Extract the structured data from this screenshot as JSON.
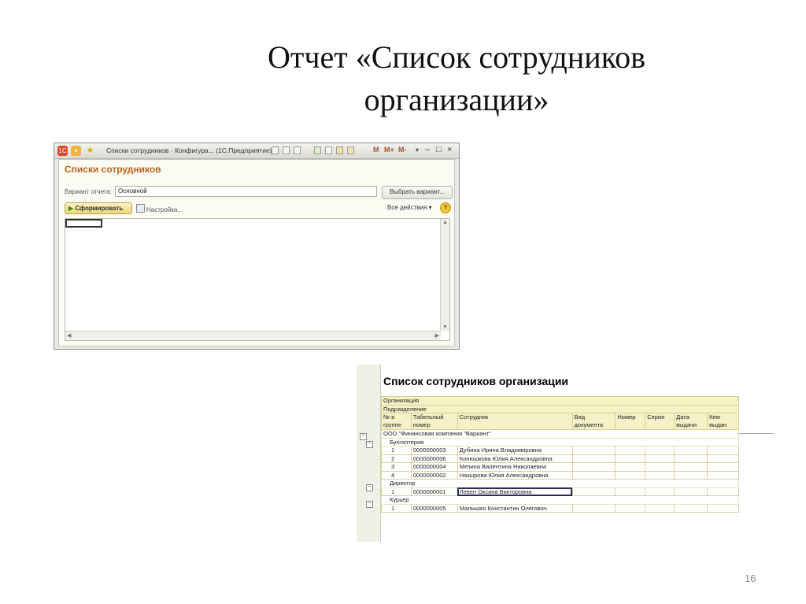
{
  "slide": {
    "title_line1": "Отчет «Список сотрудников",
    "title_line2": "организации»",
    "page_number": "16"
  },
  "window": {
    "title": "Списки сотрудников - Конфигура... (1С:Предприятие)",
    "toolbar_m_labels": [
      "M",
      "M+",
      "M-"
    ],
    "controls": {
      "minimize": "–",
      "maximize": "□",
      "close": "×"
    },
    "form_heading": "Списки сотрудников",
    "variant_label": "Вариант отчета:",
    "variant_value": "Основной",
    "choose_variant_button": "Выбрать вариант...",
    "generate_button": "Сформировать",
    "settings_link": "Настройка...",
    "all_actions": "Все действия",
    "help": "?"
  },
  "report": {
    "title": "Список сотрудников организации",
    "param_org": "Организация",
    "param_dept": "Подразделение",
    "columns": [
      [
        "№ в",
        "группе"
      ],
      [
        "Табельный",
        "номер"
      ],
      [
        "Сотрудник",
        ""
      ],
      [
        "Вид",
        "документа"
      ],
      [
        "Номер",
        ""
      ],
      [
        "Серия",
        ""
      ],
      [
        "Дата",
        "выдачи"
      ],
      [
        "Кем",
        "выдан"
      ]
    ],
    "organization": "ООО \"Финансовая компания \"Вариант\"",
    "groups": [
      {
        "name": "Бухгалтерия",
        "rows": [
          [
            "1",
            "0000000003",
            "Дубина Ирина Владимировна"
          ],
          [
            "2",
            "0000000006",
            "Конюшкова Юлия Александровна"
          ],
          [
            "3",
            "0000000004",
            "Мезина Валентина Николаевна"
          ],
          [
            "4",
            "0000000002",
            "Назырова Юлия Александровна"
          ]
        ]
      },
      {
        "name": "Директор",
        "rows": [
          [
            "1",
            "0000000001",
            "Левен Оксана Викторовна"
          ]
        ]
      },
      {
        "name": "Курьер",
        "rows": [
          [
            "1",
            "0000000005",
            "Малышко Константин Олегович"
          ]
        ]
      }
    ]
  }
}
